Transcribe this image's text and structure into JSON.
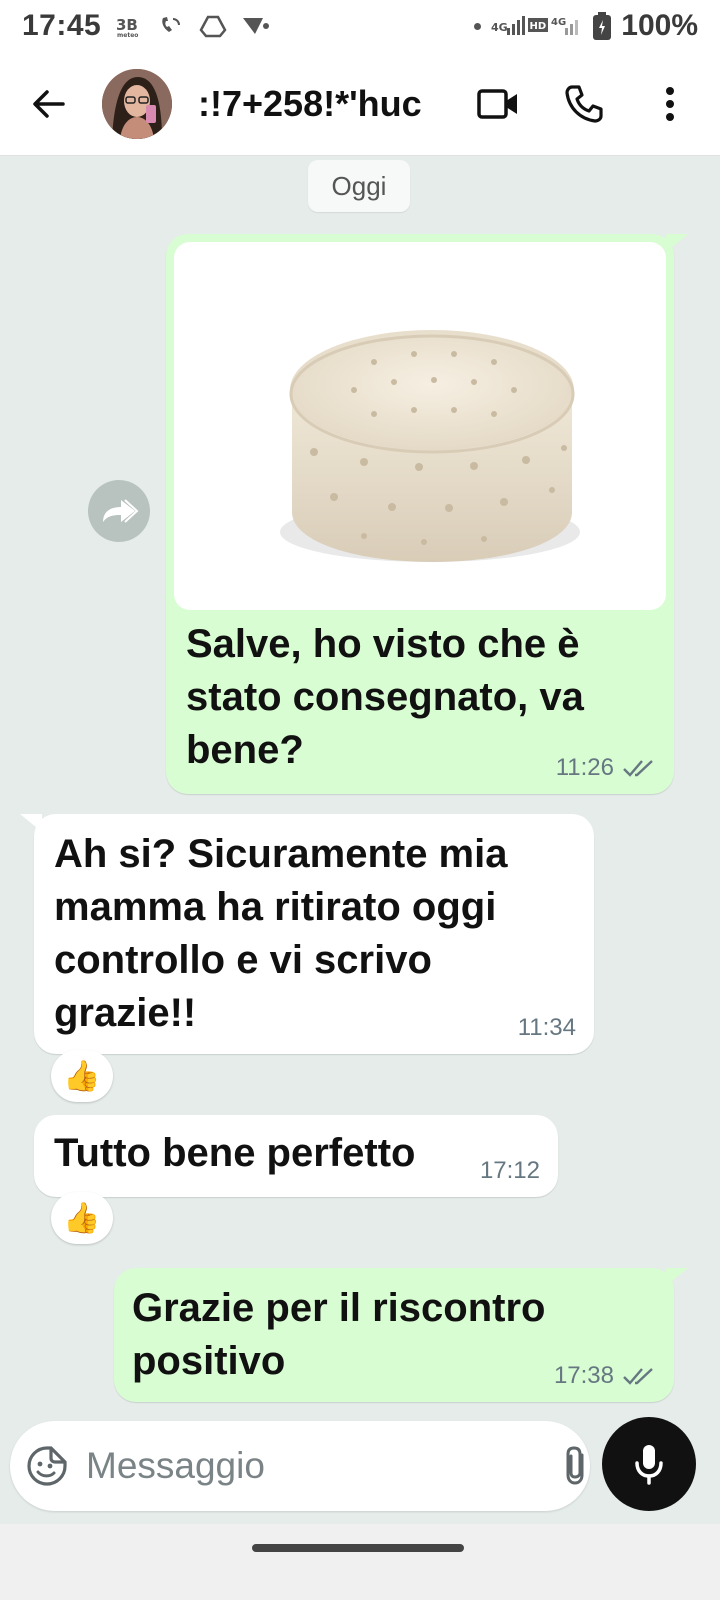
{
  "status_bar": {
    "time": "17:45",
    "battery": "100%",
    "network_4g_left": "4G",
    "network_hd": "HD",
    "network_4g_right": "4G"
  },
  "header": {
    "contact_name": ":!7+258!*'huc",
    "icons": [
      "back-arrow-icon",
      "video-call-icon",
      "phone-icon",
      "more-vert-icon"
    ]
  },
  "chat": {
    "date_chip": "Oggi",
    "messages": [
      {
        "direction": "out",
        "type": "image",
        "text": "Salve, ho visto che è stato consegnato, va bene?",
        "time": "11:26",
        "status": "read"
      },
      {
        "direction": "in",
        "type": "text",
        "text": "Ah si? Sicuramente mia mamma ha ritirato oggi controllo e vi scrivo grazie!!",
        "time": "11:34",
        "reaction": "👍"
      },
      {
        "direction": "in",
        "type": "text",
        "text": "Tutto bene perfetto",
        "time": "17:12",
        "reaction": "👍"
      },
      {
        "direction": "out",
        "type": "text",
        "text": "Grazie per il riscontro positivo",
        "time": "17:38",
        "status": "read"
      }
    ]
  },
  "composer": {
    "placeholder": "Messaggio",
    "icons": [
      "sticker-icon",
      "attach-icon",
      "camera-icon",
      "mic-icon"
    ]
  },
  "colors": {
    "outgoing_bubble": "#d9fdd3",
    "incoming_bubble": "#ffffff",
    "chat_background": "#e5ece9",
    "mic_button": "#111111"
  }
}
